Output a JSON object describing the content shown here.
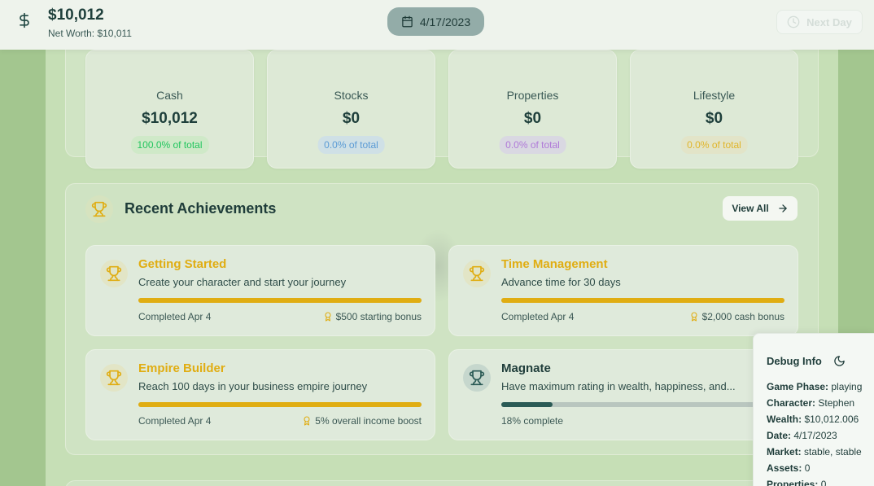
{
  "header": {
    "cash": "$10,012",
    "net_worth": "Net Worth: $10,011",
    "date": "4/17/2023",
    "next_day_label": "Next Day"
  },
  "assets": [
    {
      "label": "Cash",
      "value": "$10,012",
      "pct": "100.0% of total",
      "color": "#22c55e",
      "bg": "#cfe9c8"
    },
    {
      "label": "Stocks",
      "value": "$0",
      "pct": "0.0% of total",
      "color": "#5b9bd5",
      "bg": "#cfe0e6"
    },
    {
      "label": "Properties",
      "value": "$0",
      "pct": "0.0% of total",
      "color": "#b07ad8",
      "bg": "#d9d8e2"
    },
    {
      "label": "Lifestyle",
      "value": "$0",
      "pct": "0.0% of total",
      "color": "#e0b52a",
      "bg": "#e2e4c8"
    }
  ],
  "achievements": {
    "title": "Recent Achievements",
    "view_all": "View All",
    "items": [
      {
        "name": "Getting Started",
        "desc": "Create your character and start your journey",
        "progress": 1.0,
        "status": "Completed Apr 4",
        "reward": "$500 starting bonus",
        "completed": true
      },
      {
        "name": "Time Management",
        "desc": "Advance time for 30 days",
        "progress": 1.0,
        "status": "Completed Apr 4",
        "reward": "$2,000 cash bonus",
        "completed": true
      },
      {
        "name": "Empire Builder",
        "desc": "Reach 100 days in your business empire journey",
        "progress": 1.0,
        "status": "Completed Apr 4",
        "reward": "5% overall income boost",
        "completed": true
      },
      {
        "name": "Magnate",
        "desc": "Have maximum rating in wealth, happiness, and...",
        "progress": 0.18,
        "status": "18% complete",
        "reward": "",
        "completed": false
      }
    ]
  },
  "debug": {
    "title": "Debug Info",
    "rows": [
      {
        "key": "Game Phase:",
        "val": " playing"
      },
      {
        "key": "Character:",
        "val": " Stephen"
      },
      {
        "key": "Wealth:",
        "val": " $10,012.006"
      },
      {
        "key": "Date:",
        "val": " 4/17/2023"
      },
      {
        "key": "Market:",
        "val": " stable, stable"
      },
      {
        "key": "Assets:",
        "val": " 0"
      },
      {
        "key": "Properties:",
        "val": " 0"
      }
    ]
  },
  "colors": {
    "gold": "#e0ad12",
    "teal": "#2a5a55",
    "bar_track": "#b9c6bf"
  }
}
